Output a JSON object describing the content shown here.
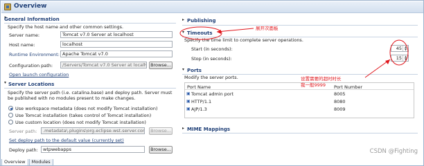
{
  "header": {
    "title": "Overview"
  },
  "general": {
    "title": "General Information",
    "description": "Specify the host name and other common settings.",
    "server_name_label": "Server name:",
    "server_name_value": "Tomcat v7.0 Server at localhost",
    "host_name_label": "Host name:",
    "host_name_value": "localhost",
    "runtime_label": "Runtime Environment:",
    "runtime_value": "Apache Tomcat v7.0",
    "config_path_label": "Configuration path:",
    "config_path_value": "/Servers/Tomcat v7.0 Server at localhos",
    "browse_label": "Browse...",
    "open_launch_label": "Open launch configuration"
  },
  "locations": {
    "title": "Server Locations",
    "description": "Specify the server path (i.e. catalina.base) and deploy path. Server must be published with no modules present to make changes.",
    "option1": "Use workspace metadata (does not modify Tomcat installation)",
    "option2": "Use Tomcat installation (takes control of Tomcat installation)",
    "option3": "Use custom location (does not modify Tomcat installation)",
    "server_path_label": "Server path:",
    "server_path_value": ".metadata\\.plugins\\org.eclipse.wst.server.core\\",
    "browse_label": "Browse...",
    "set_default_label": "Set deploy path to the default value (currently set)",
    "deploy_path_label": "Deploy path:",
    "deploy_path_value": "wtpwebapps",
    "deploy_browse_label": "Browse..."
  },
  "publishing": {
    "title": "Publishing"
  },
  "timeouts": {
    "title": "Timeouts",
    "description": "Specify the time limit to complete server operations.",
    "start_label": "Start (in seconds):",
    "start_value": "45",
    "stop_label": "Stop (in seconds):",
    "stop_value": "15"
  },
  "ports": {
    "title": "Ports",
    "description": "Modify the server ports.",
    "col_name": "Port Name",
    "col_number": "Port Number",
    "rows": [
      {
        "name": "Tomcat admin port",
        "number": "8005"
      },
      {
        "name": "HTTP/1.1",
        "number": "8080"
      },
      {
        "name": "AJP/1.3",
        "number": "8009"
      }
    ]
  },
  "mime": {
    "title": "MIME Mappings"
  },
  "annotations": {
    "expand_note": "展开次面板",
    "timeout_note_1": "设置需要的超时时长",
    "timeout_note_2": "我一般9999",
    "color": "#e0151b"
  },
  "tabs": [
    {
      "label": "Overview"
    },
    {
      "label": "Modules"
    }
  ],
  "watermark": "CSDN @Fighting"
}
